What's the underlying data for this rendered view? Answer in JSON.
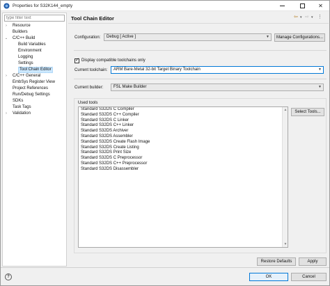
{
  "window": {
    "title": "Properties for S32K144_empty"
  },
  "filter": {
    "placeholder": "type filter text"
  },
  "tree": {
    "items": [
      {
        "label": "Resource",
        "level": 1,
        "expander": "right"
      },
      {
        "label": "Builders",
        "level": 1,
        "expander": ""
      },
      {
        "label": "C/C++ Build",
        "level": 1,
        "expander": "down"
      },
      {
        "label": "Build Variables",
        "level": 2,
        "expander": ""
      },
      {
        "label": "Environment",
        "level": 2,
        "expander": ""
      },
      {
        "label": "Logging",
        "level": 2,
        "expander": ""
      },
      {
        "label": "Settings",
        "level": 2,
        "expander": ""
      },
      {
        "label": "Tool Chain Editor",
        "level": 2,
        "expander": "",
        "selected": true
      },
      {
        "label": "C/C++ General",
        "level": 1,
        "expander": "right"
      },
      {
        "label": "EmbSys Register View",
        "level": 1,
        "expander": ""
      },
      {
        "label": "Project References",
        "level": 1,
        "expander": ""
      },
      {
        "label": "Run/Debug Settings",
        "level": 1,
        "expander": ""
      },
      {
        "label": "SDKs",
        "level": 1,
        "expander": ""
      },
      {
        "label": "Task Tags",
        "level": 1,
        "expander": ""
      },
      {
        "label": "Validation",
        "level": 1,
        "expander": "right"
      }
    ]
  },
  "page": {
    "title": "Tool Chain Editor",
    "configuration_label": "Configuration:",
    "configuration_value": "Debug  [ Active ]",
    "manage_button": "Manage Configurations...",
    "display_compatible_label": "Display compatible toolchains only",
    "display_compatible_checked": true,
    "current_toolchain_label": "Current toolchain:",
    "current_toolchain_value": "ARM Bare-Metal 32-bit Target Binary Toolchain",
    "current_builder_label": "Current builder:",
    "current_builder_value": "FSL Make Builder",
    "used_tools_label": "Used tools",
    "select_tools_button": "Select Tools...",
    "tools": [
      "Standard S32DS C Compiler",
      "Standard S32DS C++ Compiler",
      "Standard S32DS C Linker",
      "Standard S32DS C++ Linker",
      "Standard S32DS Archiver",
      "Standard S32DS Assembler",
      "Standard S32DS Create Flash Image",
      "Standard S32DS Create Listing",
      "Standard S32DS Print Size",
      "Standard S32DS C Preprocessor",
      "Standard S32DS C++ Preprocessor",
      "Standard S32DS Disassembler"
    ],
    "restore_defaults_button": "Restore Defaults",
    "apply_button": "Apply"
  },
  "dialog": {
    "ok_button": "OK",
    "cancel_button": "Cancel",
    "help_label": "?"
  },
  "colors": {
    "accent": "#0078d7",
    "selection": "#cce8ff"
  }
}
